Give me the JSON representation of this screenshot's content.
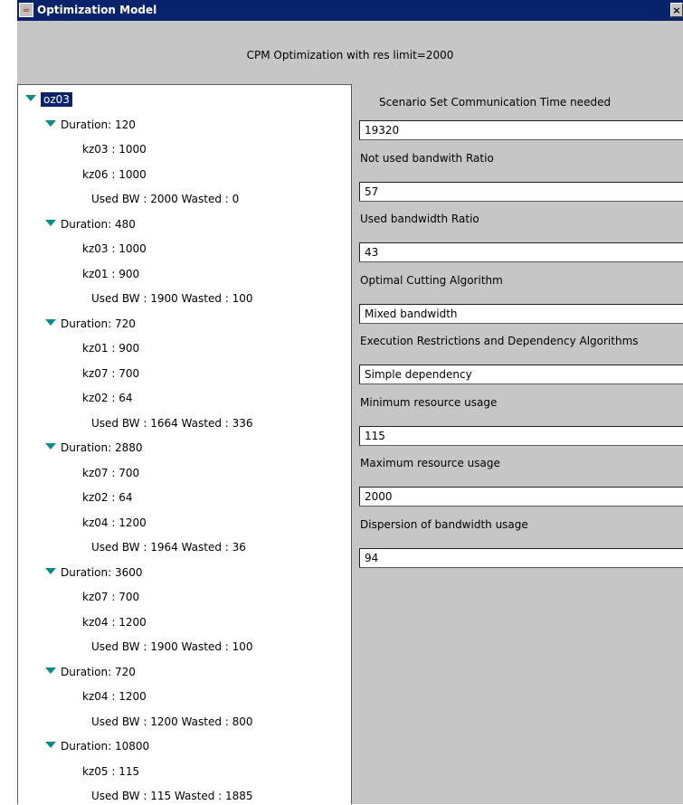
{
  "window": {
    "title": "Optimization Model",
    "close_glyph": "×",
    "app_icon_glyph": "☕"
  },
  "header": {
    "label": "CPM Optimization with res limit=2000"
  },
  "tree": {
    "root": "oz03",
    "groups": [
      {
        "duration": "Duration: 120",
        "items": [
          "kz03 : 1000",
          "kz06 : 1000"
        ],
        "summary": "Used BW : 2000 Wasted : 0"
      },
      {
        "duration": "Duration: 480",
        "items": [
          "kz03 : 1000",
          "kz01 : 900"
        ],
        "summary": "Used BW : 1900 Wasted : 100"
      },
      {
        "duration": "Duration: 720",
        "items": [
          "kz01 : 900",
          "kz07 : 700",
          "kz02 : 64"
        ],
        "summary": "Used BW : 1664 Wasted : 336"
      },
      {
        "duration": "Duration: 2880",
        "items": [
          "kz07 : 700",
          "kz02 : 64",
          "kz04 : 1200"
        ],
        "summary": "Used BW : 1964 Wasted : 36"
      },
      {
        "duration": "Duration: 3600",
        "items": [
          "kz07 : 700",
          "kz04 : 1200"
        ],
        "summary": "Used BW : 1900 Wasted : 100"
      },
      {
        "duration": "Duration: 720",
        "items": [
          "kz04 : 1200"
        ],
        "summary": "Used BW : 1200 Wasted : 800"
      },
      {
        "duration": "Duration: 10800",
        "items": [
          "kz05 : 115"
        ],
        "summary": "Used BW : 115 Wasted : 1885"
      }
    ]
  },
  "fields": [
    {
      "label": "Scenario Set Communication Time needed",
      "value": "19320"
    },
    {
      "label": "Not used bandwith Ratio",
      "value": "57"
    },
    {
      "label": "Used bandwidth Ratio",
      "value": "43"
    },
    {
      "label": "Optimal Cutting Algorithm",
      "value": "Mixed bandwidth"
    },
    {
      "label": "Execution Restrictions and Dependency Algorithms",
      "value": "Simple dependency"
    },
    {
      "label": "Minimum resource usage",
      "value": "115"
    },
    {
      "label": "Maximum resource usage",
      "value": "2000"
    },
    {
      "label": "Dispersion of bandwidth usage",
      "value": "94"
    }
  ]
}
